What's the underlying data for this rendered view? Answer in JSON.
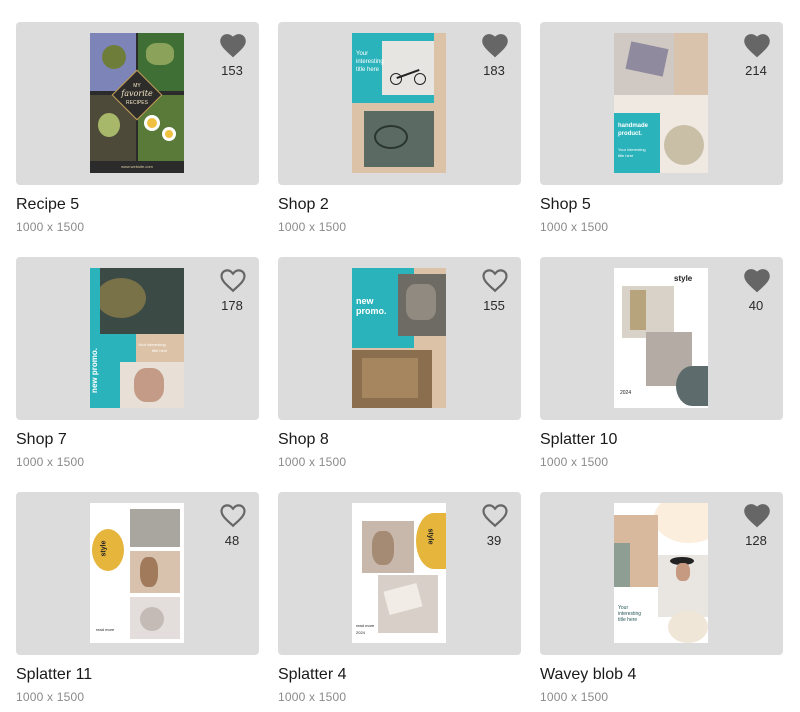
{
  "colors": {
    "card_bg": "#dcdcdd",
    "heart_filled": "#666666",
    "heart_outline": "#666666",
    "teal": "#2bb3bb",
    "tan": "#dcc2a6",
    "mustard": "#e5b53c"
  },
  "templates": [
    {
      "title": "Recipe 5",
      "size": "1000 x 1500",
      "likes": "153",
      "liked": true,
      "poster_text": {
        "line1": "MY",
        "line2": "favorite",
        "line3": "RECIPES",
        "footer": "www.website.com"
      }
    },
    {
      "title": "Shop 2",
      "size": "1000 x 1500",
      "likes": "183",
      "liked": true,
      "poster_text": {
        "line1": "Your",
        "line2": "interesting",
        "line3": "title here"
      }
    },
    {
      "title": "Shop 5",
      "size": "1000 x 1500",
      "likes": "214",
      "liked": true,
      "poster_text": {
        "line1": "handmade",
        "line2": "product.",
        "line3": "Your interesting",
        "line4": "title here"
      }
    },
    {
      "title": "Shop 7",
      "size": "1000 x 1500",
      "likes": "178",
      "liked": false,
      "poster_text": {
        "line1": "new promo.",
        "line2": "Your interesting",
        "line3": "title here"
      }
    },
    {
      "title": "Shop 8",
      "size": "1000 x 1500",
      "likes": "155",
      "liked": false,
      "poster_text": {
        "line1": "new",
        "line2": "promo."
      }
    },
    {
      "title": "Splatter 10",
      "size": "1000 x 1500",
      "likes": "40",
      "liked": true,
      "poster_text": {
        "line1": "style",
        "line2": "2024"
      }
    },
    {
      "title": "Splatter 11",
      "size": "1000 x 1500",
      "likes": "48",
      "liked": false,
      "poster_text": {
        "line1": "style",
        "line2": "read more"
      }
    },
    {
      "title": "Splatter 4",
      "size": "1000 x 1500",
      "likes": "39",
      "liked": false,
      "poster_text": {
        "line1": "style",
        "line2": "read more",
        "line3": "2024"
      }
    },
    {
      "title": "Wavey blob 4",
      "size": "1000 x 1500",
      "likes": "128",
      "liked": true,
      "poster_text": {
        "line1": "Your",
        "line2": "interesting",
        "line3": "title here"
      }
    }
  ]
}
